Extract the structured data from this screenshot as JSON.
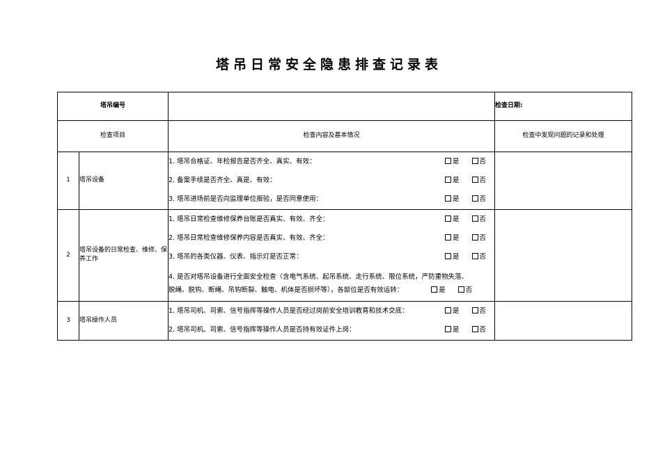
{
  "document": {
    "title": "塔吊日常安全隐患排查记录表"
  },
  "table": {
    "header": {
      "crane_no_label": "塔吊编号",
      "crane_no_value": "",
      "inspect_date_label": "检查日期:",
      "inspect_date_value": ""
    },
    "columns": {
      "no": "",
      "item": "检查项目",
      "content": "检查内容及基本情况",
      "remark": "检查中发现问题的记录和处理"
    },
    "options": {
      "yes": "是",
      "no": "否"
    },
    "rows": [
      {
        "no": "1",
        "item": "塔吊设备",
        "remark": "",
        "checks": [
          {
            "text": "1. 塔吊合格证、年检报告是否齐全、真实、有效：",
            "layout": "single"
          },
          {
            "text": "2. 备案手续是否齐全、真是、有效：",
            "layout": "single"
          },
          {
            "text": "3. 塔吊进场前是否向监理单位报验，是否同意使用：",
            "layout": "single"
          }
        ]
      },
      {
        "no": "2",
        "item": "塔吊设备的日常检查、维修、保养工作",
        "remark": "",
        "checks": [
          {
            "text": "1. 塔吊日常检查维修保养台账是否真实、有效、齐全：",
            "layout": "single"
          },
          {
            "text": "2. 塔吊日常检查维修保养内容是否真实、有效、齐全：",
            "layout": "single"
          },
          {
            "text": "3. 塔吊的各类仪器、仪表、指示灯是否正常：",
            "layout": "single"
          },
          {
            "layout": "wrapped",
            "line1": "4. 是否对塔吊设备进行全面安全检查（含电气系统、起吊系统、走行系统、限位系统，严防重物失落、",
            "line2": "脱绳、脱钩、断绳、吊钩断裂、触电、机体是否损坏等），各部位是否有效运转："
          }
        ]
      },
      {
        "no": "3",
        "item": "塔吊操作人员",
        "remark": "",
        "checks": [
          {
            "text": "1. 塔吊司机、司索、信号指挥等操作人员是否经过岗前安全培训教育和技术交底：",
            "layout": "single"
          },
          {
            "text": "2. 塔吊司机、司索、信号指挥等操作人员是否持有效证件上岗：",
            "layout": "single"
          }
        ]
      }
    ]
  }
}
